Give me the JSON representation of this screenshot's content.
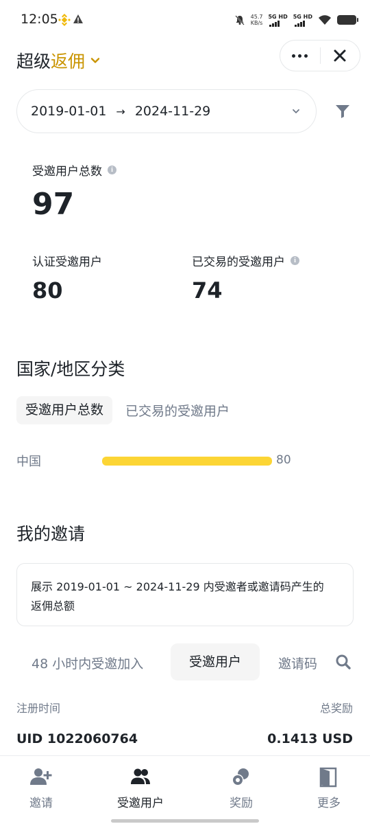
{
  "status_bar": {
    "time": "12:05",
    "speed_value": "45.7",
    "speed_unit": "KB/s",
    "net1": "5G HD",
    "net2": "5G HD"
  },
  "header": {
    "title_prefix": "超级",
    "title_accent": "返佣",
    "accent_color": "#c99400"
  },
  "date_range": {
    "start": "2019-01-01",
    "arrow": "→",
    "end": "2024-11-29"
  },
  "stats": {
    "total_label": "受邀用户总数",
    "total_value": "97",
    "verified_label": "认证受邀用户",
    "verified_value": "80",
    "traded_label": "已交易的受邀用户",
    "traded_value": "74"
  },
  "region": {
    "title": "国家/地区分类",
    "tabs": [
      "受邀用户总数",
      "已交易的受邀用户"
    ],
    "rows": [
      {
        "name": "中国",
        "value": "80",
        "fraction": 1.0
      }
    ],
    "bar_color": "#fcd535"
  },
  "invites": {
    "title": "我的邀请",
    "notice_line1": "展示 2019-01-01 ~ 2024-11-29 内受邀者或邀请码产生的",
    "notice_line2": "返佣总额",
    "tabs": [
      "48 小时内受邀加入",
      "受邀用户",
      "邀请码"
    ],
    "col_left": "注册时间",
    "col_right": "总奖励",
    "rows": [
      {
        "uid": "UID 1022060764",
        "amount": "0.1413 USD"
      }
    ]
  },
  "bottom_nav": {
    "items": [
      {
        "label": "邀请",
        "icon": "add-user-icon"
      },
      {
        "label": "受邀用户",
        "icon": "users-icon"
      },
      {
        "label": "奖励",
        "icon": "coins-icon"
      },
      {
        "label": "更多",
        "icon": "more-door-icon"
      }
    ],
    "active_index": 1
  }
}
